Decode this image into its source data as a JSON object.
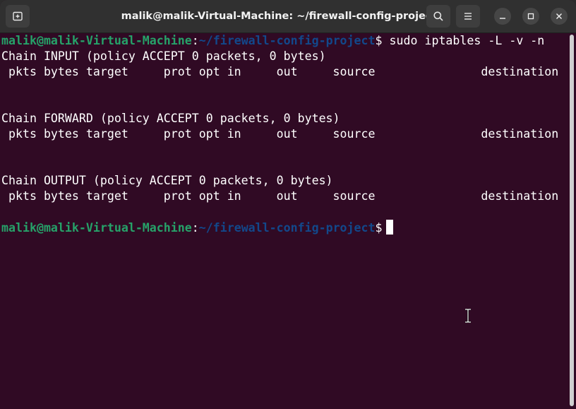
{
  "window": {
    "title": "malik@malik-Virtual-Machine: ~/firewall-config-project"
  },
  "titlebar": {
    "new_tab_icon": "new-tab-icon",
    "search_icon": "search-icon",
    "menu_icon": "hamburger-menu-icon",
    "minimize_icon": "minimize-icon",
    "maximize_icon": "maximize-icon",
    "close_icon": "close-icon"
  },
  "colors": {
    "background": "#300a24",
    "prompt_user": "#26a269",
    "prompt_path": "#12488b",
    "text": "#ffffff"
  },
  "terminal": {
    "prompt_user": "malik@malik-Virtual-Machine",
    "prompt_sep": ":",
    "prompt_path": "~/firewall-config-project",
    "prompt_symbol": "$",
    "command": " sudo iptables -L -v -n",
    "output": [
      "Chain INPUT (policy ACCEPT 0 packets, 0 bytes)",
      " pkts bytes target     prot opt in     out     source               destination",
      "",
      "",
      "Chain FORWARD (policy ACCEPT 0 packets, 0 bytes)",
      " pkts bytes target     prot opt in     out     source               destination",
      "",
      "",
      "Chain OUTPUT (policy ACCEPT 0 packets, 0 bytes)",
      " pkts bytes target     prot opt in     out     source               destination",
      ""
    ]
  }
}
